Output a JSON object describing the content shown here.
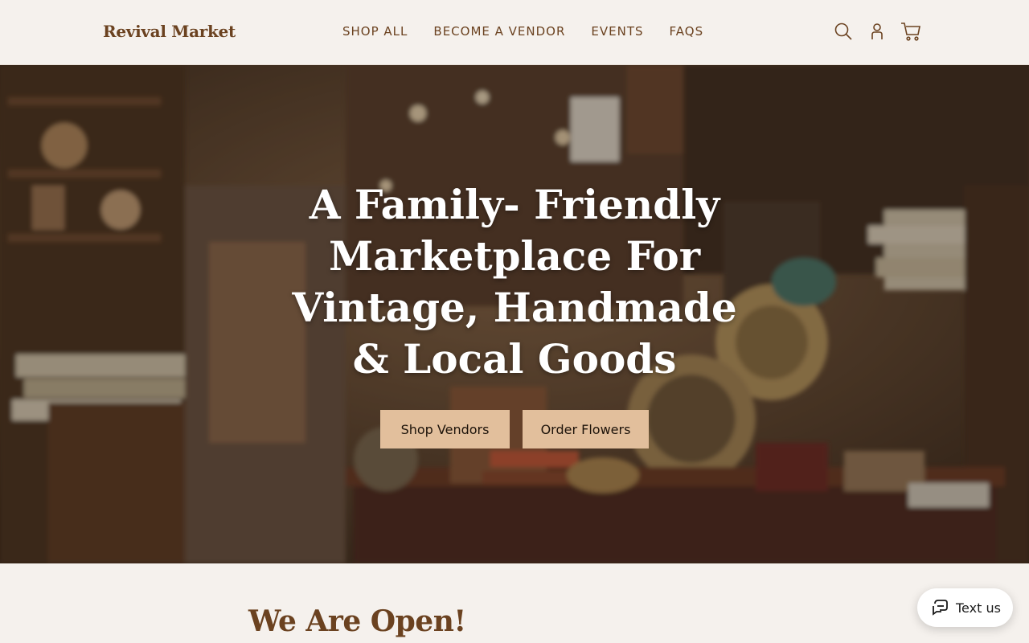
{
  "header": {
    "logo": "Revival Market",
    "nav": [
      "SHOP ALL",
      "BECOME A VENDOR",
      "EVENTS",
      "FAQS"
    ],
    "icons": [
      "search-icon",
      "account-icon",
      "cart-icon"
    ]
  },
  "hero": {
    "title": "A Family- Friendly Marketplace For Vintage, Handmade & Local Goods",
    "buttons": {
      "shop_vendors": "Shop Vendors",
      "order_flowers": "Order Flowers"
    }
  },
  "section": {
    "title": "We Are Open!"
  },
  "widget": {
    "label": "Text us"
  },
  "colors": {
    "brand": "#6b4220",
    "button": "#e2bf9c",
    "background": "#f5f1ed"
  }
}
